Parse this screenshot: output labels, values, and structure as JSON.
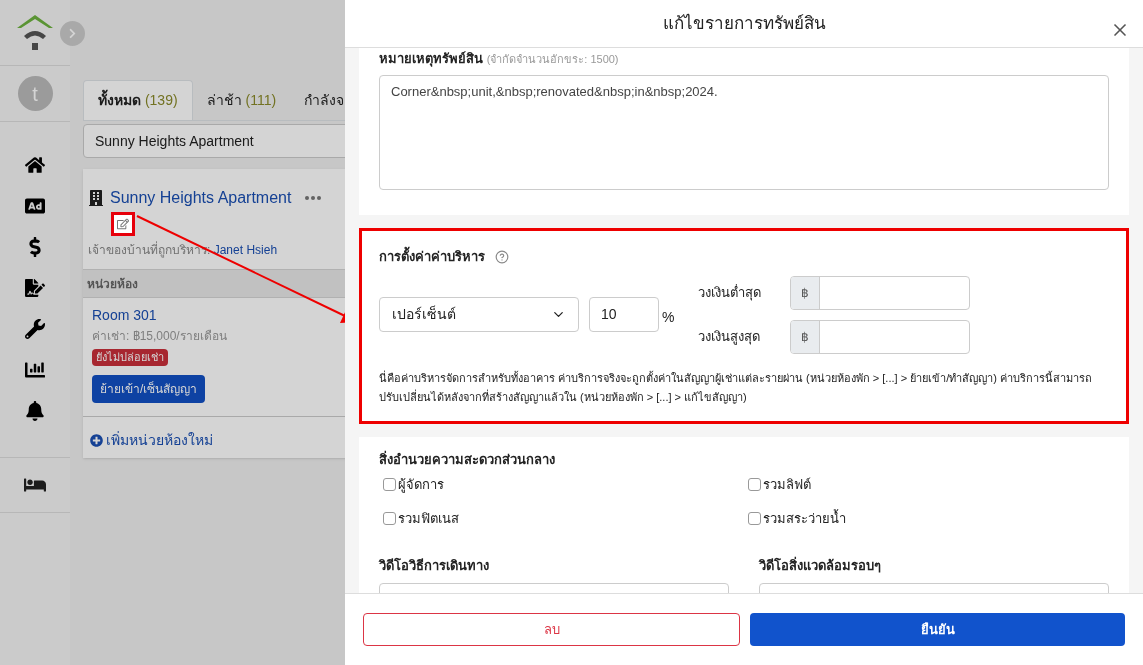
{
  "sidebar": {
    "avatar": "t"
  },
  "background": {
    "tabs": [
      {
        "label": "ทั้งหมด",
        "count": "(139)",
        "selected": true
      },
      {
        "label": "ล่าช้า",
        "count": "(111)",
        "selected": false
      },
      {
        "label": "กำลังจ",
        "selected": false
      }
    ],
    "search": {
      "value": "Sunny Heights Apartment"
    },
    "property": {
      "name": "Sunny Heights Apartment",
      "owner_label": "เจ้าของบ้านที่ถูกบริหาร:",
      "owner": "Janet Hsieh",
      "units_header": "หน่วยห้อง",
      "units": [
        {
          "name": "Room 301",
          "rent": "ค่าเช่า: ฿15,000/รายเดือน",
          "status": "ยังไม่ปล่อยเช่า",
          "action": "ย้ายเข้า/เซ็นสัญญา"
        }
      ],
      "add_unit": "เพิ่มหน่วยห้องใหม่"
    }
  },
  "dialog": {
    "title": "แก้ไขรายการทรัพย์สิน",
    "notes": {
      "label": "หมายเหตุทรัพย์สิน",
      "hint": "(จำกัดจำนวนอักขระ: 1500)",
      "value": "Corner&nbsp;unit,&nbsp;renovated&nbsp;in&nbsp;2024."
    },
    "fee": {
      "title": "การตั้งค่าค่าบริหาร",
      "type": "เปอร์เซ็นต์",
      "value": "10",
      "unit": "%",
      "min_label": "วงเงินต่ำสุด",
      "max_label": "วงเงินสูงสุด",
      "min_currency": "฿",
      "max_currency": "฿",
      "note": "นี่คือค่าบริหารจัดการสำหรับทั้งอาคาร ค่าบริการจริงจะถูกตั้งค่าในสัญญาผู้เช่าแต่ละรายผ่าน (หน่วยห้องพัก > [...] > ย้ายเข้า/ทำสัญญา) ค่าบริการนี้สามารถปรับเปลี่ยนได้หลังจากที่สร้างสัญญาแล้วใน (หน่วยห้องพัก > [...] > แก้ไขสัญญา)"
    },
    "amenities": {
      "title": "สิ่งอำนวยความสะดวกส่วนกลาง",
      "items": [
        {
          "label": "ผู้จัดการ",
          "checked": false
        },
        {
          "label": "รวมลิฟต์",
          "checked": false
        },
        {
          "label": "รวมฟิตเนส",
          "checked": false
        },
        {
          "label": "รวมสระว่ายน้ำ",
          "checked": false
        }
      ]
    },
    "videos": [
      {
        "label": "วิดีโอวิธีการเดินทาง"
      },
      {
        "label": "วิดีโอสิ่งแวดล้อมรอบๆ"
      }
    ],
    "delete_button": "ลบ",
    "confirm_button": "ยืนยัน"
  }
}
